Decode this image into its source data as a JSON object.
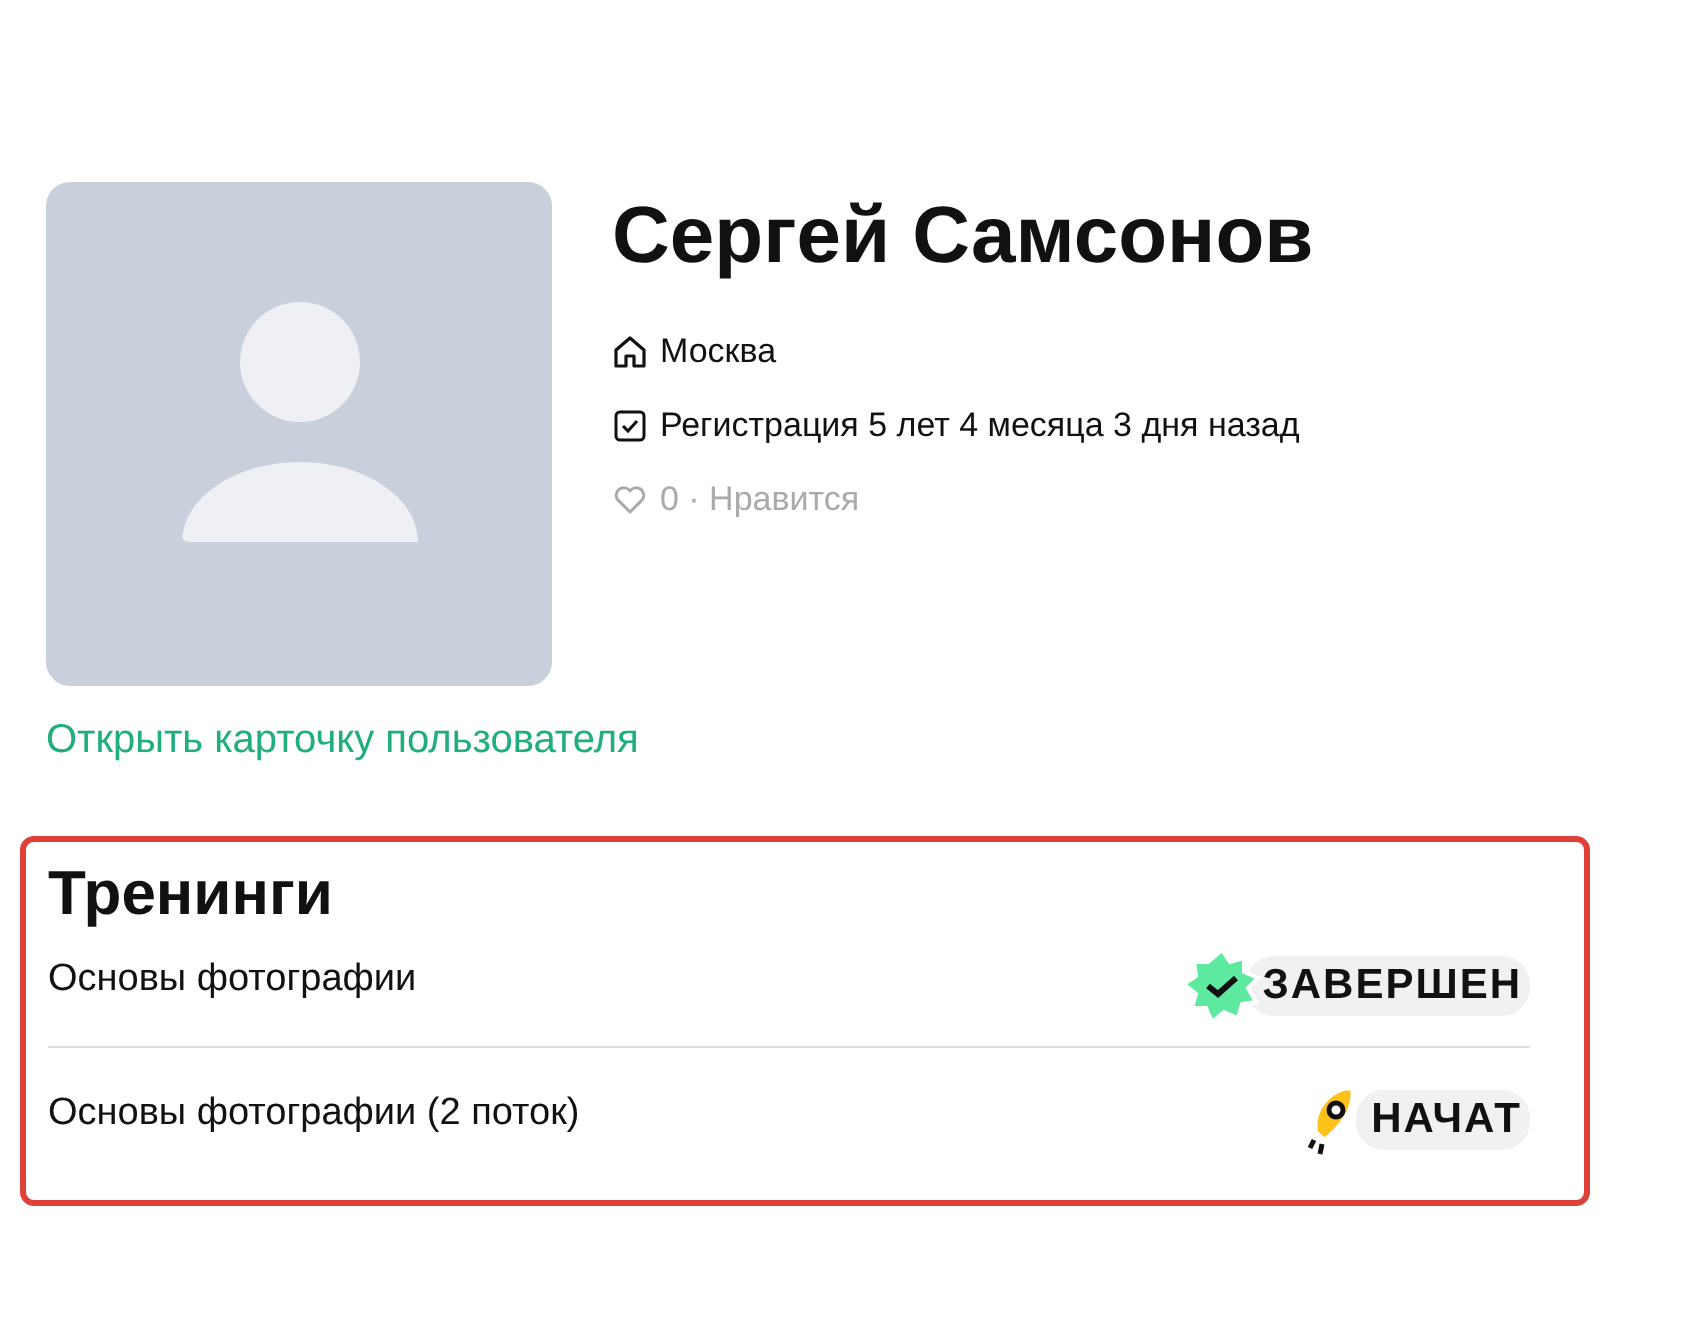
{
  "profile": {
    "name": "Сергей Самсонов",
    "city": "Москва",
    "registration": "Регистрация 5 лет 4 месяца 3 дня назад",
    "likes": "0 · Нравится",
    "card_link": "Открыть карточку пользователя"
  },
  "trainings": {
    "title": "Тренинги",
    "items": [
      {
        "title": "Основы фотографии",
        "status": {
          "kind": "completed",
          "label": "ЗАВЕРШЕН"
        }
      },
      {
        "title": "Основы фотографии (2 поток)",
        "status": {
          "kind": "started",
          "label": "НАЧАТ"
        }
      }
    ]
  }
}
